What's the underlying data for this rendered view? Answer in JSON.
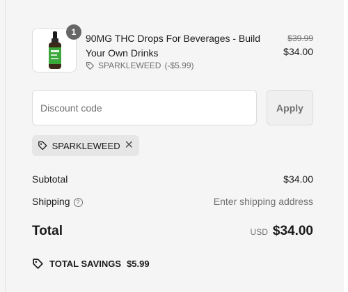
{
  "product": {
    "quantity": "1",
    "title": "90MG THC Drops For Beverages - Build Your Own Drinks",
    "discount_code": "SPARKLEWEED",
    "discount_amount": "(-$5.99)",
    "compare_price": "$39.99",
    "price": "$34.00",
    "image": "tincture-bottle-image"
  },
  "discount": {
    "placeholder": "Discount code",
    "apply_label": "Apply",
    "applied_code": "SPARKLEWEED"
  },
  "summary": {
    "subtotal_label": "Subtotal",
    "subtotal_value": "$34.00",
    "shipping_label": "Shipping",
    "shipping_value": "Enter shipping address",
    "total_label": "Total",
    "currency": "USD",
    "total_value": "$34.00",
    "savings_label": "TOTAL SAVINGS",
    "savings_value": "$5.99"
  },
  "icons": {
    "tag": "tag-icon",
    "help": "question-icon",
    "close": "close-icon"
  },
  "colors": {
    "background": "#f5f5f5",
    "text": "#1a1a1a",
    "muted": "#707070",
    "badge": "#666666",
    "bottle_label": "#3aa83a"
  }
}
